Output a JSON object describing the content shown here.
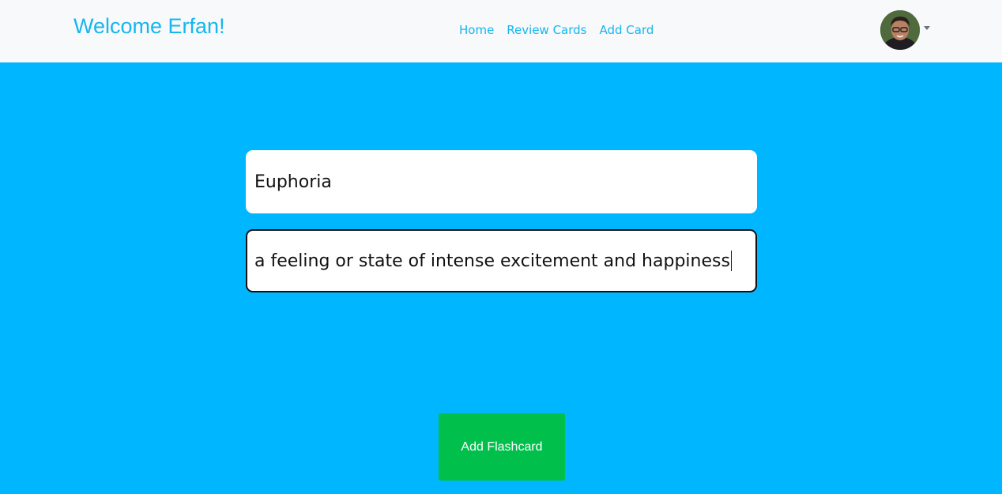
{
  "navbar": {
    "brand": "Welcome Erfan!",
    "links": [
      {
        "label": "Home"
      },
      {
        "label": "Review Cards"
      },
      {
        "label": "Add Card"
      }
    ],
    "profile_icon": "user-avatar",
    "menu_icon": "caret-down-icon"
  },
  "form": {
    "front_value": "Euphoria",
    "back_value": "a feeling or state of intense excitement and happiness",
    "submit_label": "Add Flashcard"
  },
  "colors": {
    "background": "#00b7ff",
    "navbar_bg": "#f8f9fa",
    "accent": "#16b6ee",
    "submit": "#00c04b"
  }
}
